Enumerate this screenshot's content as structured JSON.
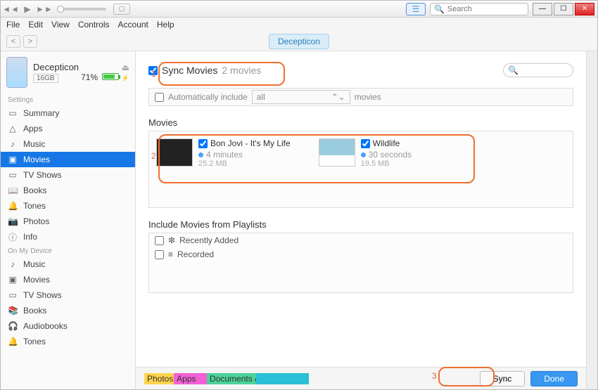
{
  "menubar": [
    "File",
    "Edit",
    "View",
    "Controls",
    "Account",
    "Help"
  ],
  "search_placeholder": "Search",
  "nav": {
    "device_tab": "Decepticon"
  },
  "device": {
    "name": "Decepticon",
    "capacity": "16GB",
    "battery_pct": "71%"
  },
  "sidebar": {
    "settings_header": "Settings",
    "settings": [
      {
        "icon": "▭",
        "label": "Summary"
      },
      {
        "icon": "△",
        "label": "Apps"
      },
      {
        "icon": "♪",
        "label": "Music"
      },
      {
        "icon": "▣",
        "label": "Movies"
      },
      {
        "icon": "▭",
        "label": "TV Shows"
      },
      {
        "icon": "📖",
        "label": "Books"
      },
      {
        "icon": "🔔",
        "label": "Tones"
      },
      {
        "icon": "📷",
        "label": "Photos"
      },
      {
        "icon": "ⓘ",
        "label": "Info"
      }
    ],
    "device_header": "On My Device",
    "device_items": [
      {
        "icon": "♪",
        "label": "Music"
      },
      {
        "icon": "▣",
        "label": "Movies"
      },
      {
        "icon": "▭",
        "label": "TV Shows"
      },
      {
        "icon": "📚",
        "label": "Books"
      },
      {
        "icon": "🎧",
        "label": "Audiobooks"
      },
      {
        "icon": "🔔",
        "label": "Tones"
      }
    ]
  },
  "sync": {
    "label": "Sync Movies",
    "count": "2 movies"
  },
  "auto": {
    "label": "Automatically include",
    "select": "all",
    "suffix": "movies"
  },
  "sections": {
    "movies": "Movies",
    "playlists": "Include Movies from Playlists"
  },
  "movies": [
    {
      "title": "Bon Jovi - It's My Life",
      "duration": "4 minutes",
      "size": "25.2 MB"
    },
    {
      "title": "Wildlife",
      "duration": "30 seconds",
      "size": "19.5 MB"
    }
  ],
  "playlists": [
    {
      "icon": "✼",
      "label": "Recently Added"
    },
    {
      "icon": "≡",
      "label": "Recorded"
    }
  ],
  "storage": {
    "photos": "Photos",
    "apps": "Apps",
    "docs": "Documents & Data"
  },
  "buttons": {
    "sync": "Sync",
    "done": "Done"
  },
  "steps": {
    "1": "1",
    "2": "2",
    "3": "3"
  }
}
